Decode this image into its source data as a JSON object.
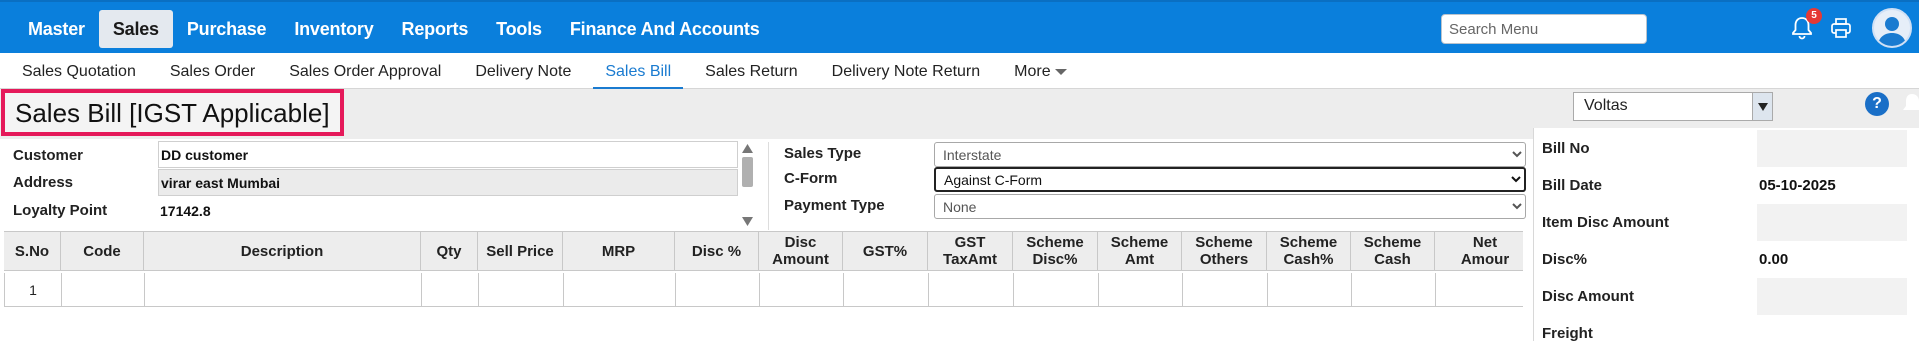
{
  "main_nav": [
    "Master",
    "Sales",
    "Purchase",
    "Inventory",
    "Reports",
    "Tools",
    "Finance And Accounts"
  ],
  "main_nav_active": "Sales",
  "search": {
    "placeholder": "Search Menu"
  },
  "notifications": {
    "count": "5"
  },
  "sub_nav": [
    "Sales Quotation",
    "Sales Order",
    "Sales Order Approval",
    "Delivery Note",
    "Sales Bill",
    "Sales Return",
    "Delivery Note Return",
    "More"
  ],
  "sub_nav_active": "Sales Bill",
  "page_title": "Sales Bill [IGST Applicable]",
  "company_select": "Voltas",
  "help_label": "?",
  "customer": {
    "customer_label": "Customer",
    "customer_value": "DD customer",
    "address_label": "Address",
    "address_value": "virar east Mumbai",
    "loyalty_label": "Loyalty Point",
    "loyalty_value": "17142.8"
  },
  "sales_info": {
    "sales_type_label": "Sales Type",
    "sales_type_value": "Interstate",
    "cform_label": "C-Form",
    "cform_value": "Against C-Form",
    "payment_type_label": "Payment Type",
    "payment_type_value": "None"
  },
  "grid": {
    "columns": [
      "S.No",
      "Code",
      "Description",
      "Qty",
      "Sell Price",
      "MRP",
      "Disc %",
      "Disc\nAmount",
      "GST%",
      "GST\nTaxAmt",
      "Scheme\nDisc%",
      "Scheme\nAmt",
      "Scheme\nOthers",
      "Scheme\nCash%",
      "Scheme\nCash",
      "Net Amour"
    ],
    "rows": [
      [
        "1",
        "",
        "",
        "",
        "",
        "",
        "",
        "",
        "",
        "",
        "",
        "",
        "",
        "",
        "",
        ""
      ]
    ]
  },
  "summary": [
    {
      "label": "Bill No",
      "value": ""
    },
    {
      "label": "Bill Date",
      "value": "05-10-2025"
    },
    {
      "label": "Item Disc Amount",
      "value": ""
    },
    {
      "label": "Disc%",
      "value": "0.00"
    },
    {
      "label": "Disc Amount",
      "value": ""
    },
    {
      "label": "Freight",
      "value": ""
    }
  ],
  "colors": {
    "topbar": "#0a7fdc",
    "active_tab": "#1a7bd0",
    "title_border": "#e5195a"
  }
}
